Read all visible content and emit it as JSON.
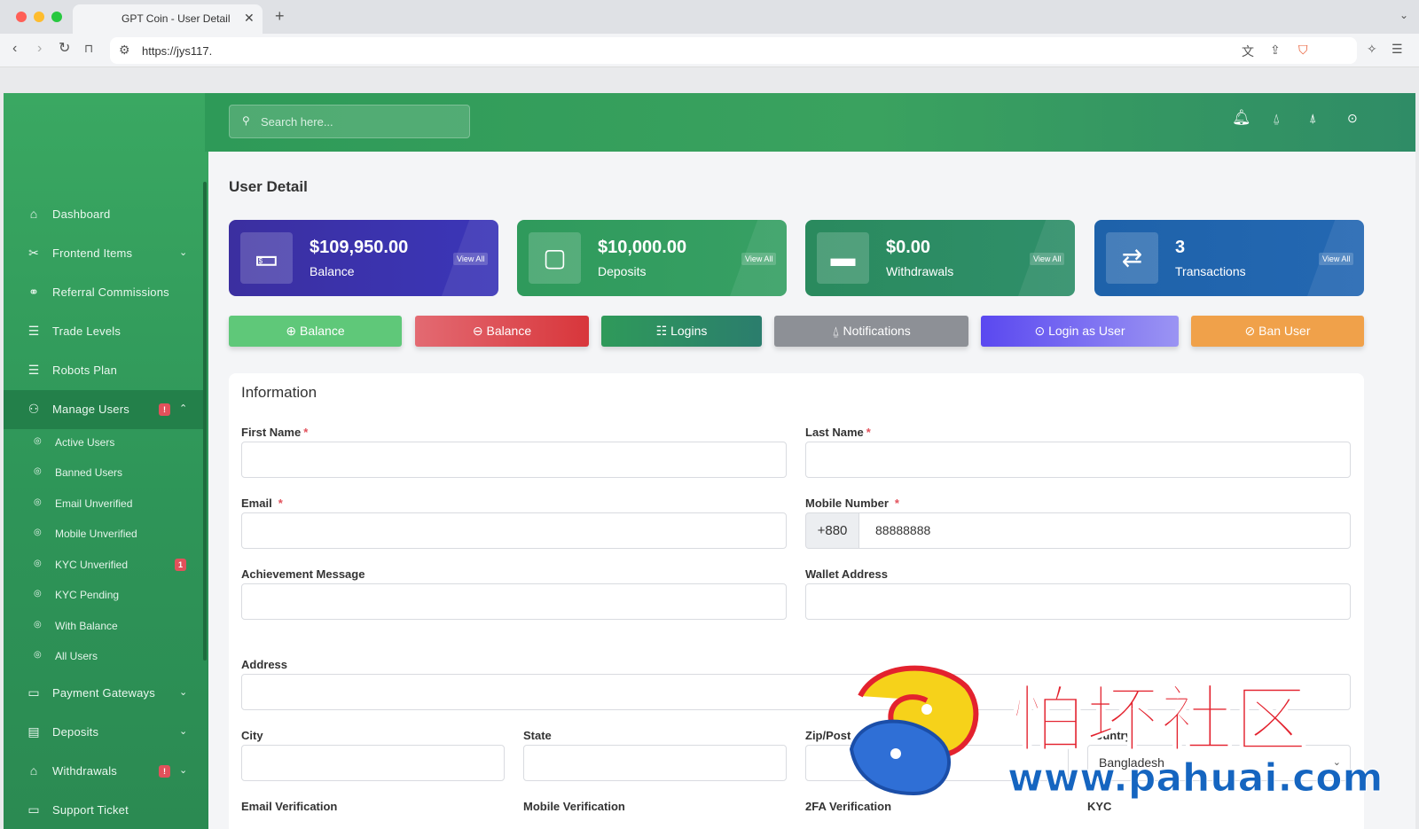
{
  "browser": {
    "tab_title": "GPT Coin - User Detail",
    "url": "https://jys117."
  },
  "sidebar": {
    "items": [
      {
        "label": "Dashboard",
        "icon": "home-icon"
      },
      {
        "label": "Frontend Items",
        "icon": "tools-icon",
        "has_children": true
      },
      {
        "label": "Referral Commissions",
        "icon": "link-icon"
      },
      {
        "label": "Trade Levels",
        "icon": "list-icon"
      },
      {
        "label": "Robots Plan",
        "icon": "list-icon"
      },
      {
        "label": "Manage Users",
        "icon": "users-icon",
        "badge": "!",
        "expanded": true
      },
      {
        "label": "Payment Gateways",
        "icon": "credit-card-icon",
        "has_children": true
      },
      {
        "label": "Deposits",
        "icon": "receipt-icon",
        "has_children": true
      },
      {
        "label": "Withdrawals",
        "icon": "bank-icon",
        "badge": "!",
        "has_children": true
      },
      {
        "label": "Support Ticket",
        "icon": "ticket-icon"
      }
    ],
    "manage_users_sub": [
      {
        "label": "Active Users"
      },
      {
        "label": "Banned Users"
      },
      {
        "label": "Email Unverified"
      },
      {
        "label": "Mobile Unverified"
      },
      {
        "label": "KYC Unverified",
        "badge": "1"
      },
      {
        "label": "KYC Pending"
      },
      {
        "label": "With Balance"
      },
      {
        "label": "All Users"
      }
    ]
  },
  "header": {
    "search_placeholder": "Search here..."
  },
  "page": {
    "title": "User Detail"
  },
  "stats": [
    {
      "amount": "$109,950.00",
      "label": "Balance",
      "link": "View All",
      "color": "#3730a3"
    },
    {
      "amount": "$10,000.00",
      "label": "Deposits",
      "link": "View All",
      "color": "#2f9a5c"
    },
    {
      "amount": "$0.00",
      "label": "Withdrawals",
      "link": "View All",
      "color": "#2d8a66"
    },
    {
      "amount": "3",
      "label": "Transactions",
      "link": "View All",
      "color": "#1f5fb0"
    }
  ],
  "actions": [
    {
      "label": "Balance",
      "icon": "plus-circle-icon",
      "color": "#5fc879"
    },
    {
      "label": "Balance",
      "icon": "minus-circle-icon",
      "color": "#dc4a50"
    },
    {
      "label": "Logins",
      "icon": "list-icon",
      "color": "#2e8b63"
    },
    {
      "label": "Notifications",
      "icon": "bell-icon",
      "color": "#8d9096"
    },
    {
      "label": "Login as User",
      "icon": "login-icon",
      "color": "#6a5cf5"
    },
    {
      "label": "Ban User",
      "icon": "ban-icon",
      "color": "#f0a14a"
    }
  ],
  "form": {
    "title": "Information",
    "first_name_label": "First Name",
    "last_name_label": "Last Name",
    "email_label": "Email",
    "mobile_label": "Mobile Number",
    "mobile_prefix": "+880",
    "mobile_value": "88888888",
    "achievement_label": "Achievement Message",
    "wallet_label": "Wallet Address",
    "address_label": "Address",
    "city_label": "City",
    "state_label": "State",
    "zip_label": "Zip/Post",
    "country_label": "Country",
    "country_value": "Bangladesh",
    "email_verification_label": "Email Verification",
    "mobile_verification_label": "Mobile Verification",
    "twofa_label": "2FA Verification",
    "kyc_label": "KYC"
  },
  "watermark": {
    "text": "怕坏社区",
    "url": "www.pahuai.com"
  }
}
